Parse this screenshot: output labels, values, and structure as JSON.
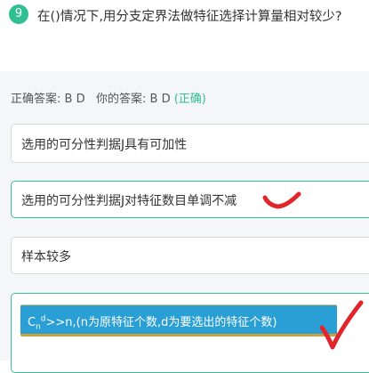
{
  "question": {
    "number": "9",
    "text": "在()情况下,用分支定界法做特征选择计算量相对较少?"
  },
  "answer": {
    "correct_label": "正确答案:",
    "correct_value": "B D",
    "yours_label": "你的答案:",
    "yours_value": "B D",
    "status": "(正确)"
  },
  "options": [
    {
      "text": "选用的可分性判据J具有可加性"
    },
    {
      "text": "选用的可分性判据J对特征数目单调不减"
    },
    {
      "text": "样本较多"
    },
    {
      "base": "C",
      "sub": "n",
      "sup": "d",
      "rest": ">>n,(n为原特征个数,d为要选出的特征个数)"
    }
  ],
  "colors": {
    "accent": "#2fbf90",
    "formula_bg": "#2a9fd6",
    "check_mark": "#e0262b"
  },
  "icons": {
    "mark_b": "red-check-icon",
    "mark_d": "red-check-icon"
  }
}
